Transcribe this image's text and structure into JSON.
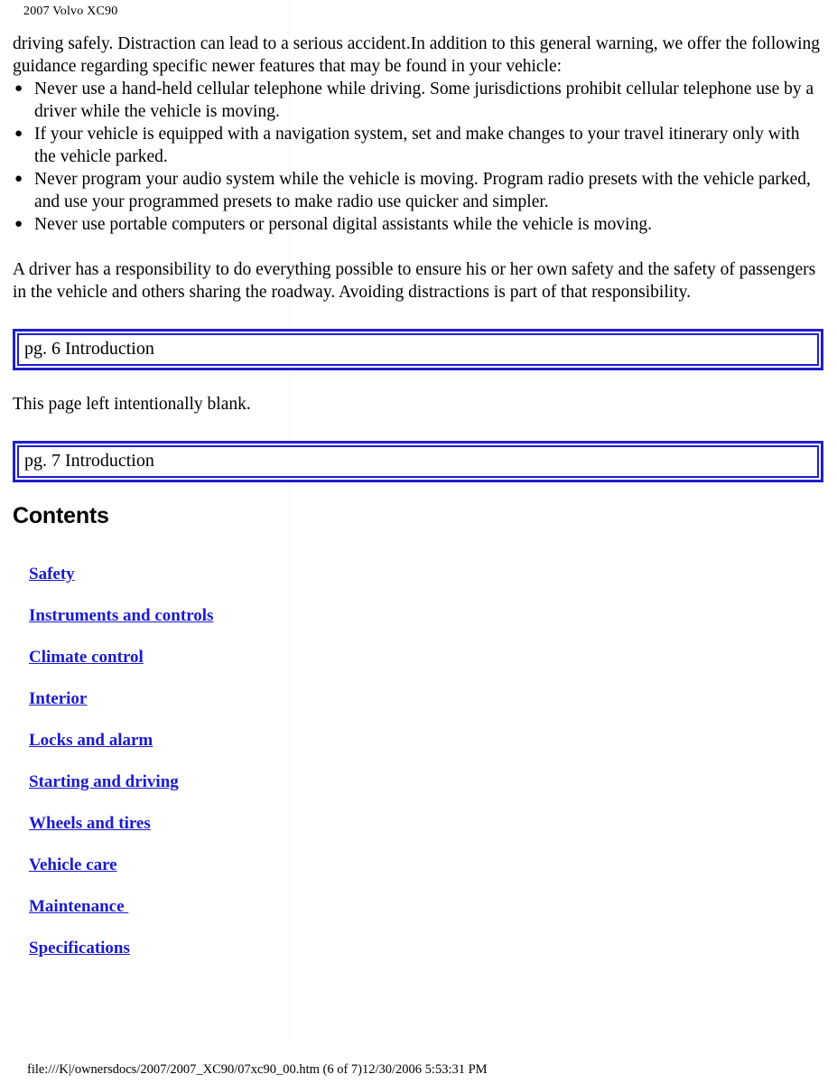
{
  "header": {
    "title": "2007 Volvo XC90"
  },
  "main": {
    "intro_paragraph": "driving safely. Distraction can lead to a serious accident.In addition to this general warning, we offer the following guidance regarding specific newer features that may be found in your vehicle:",
    "bullet_glyph": "●",
    "bullets": [
      "Never use a hand-held cellular telephone while driving. Some jurisdictions prohibit cellular telephone use by a driver while the vehicle is moving.",
      "If your vehicle is equipped with a navigation system, set and make changes to your travel itinerary only with the vehicle parked.",
      "Never program your audio system while the vehicle is moving. Program radio presets with the vehicle parked, and use your programmed presets to make radio use quicker and simpler.",
      "Never use portable computers or personal digital assistants while the vehicle is moving."
    ],
    "closing_paragraph": "A driver has a responsibility to do everything possible to ensure his or her own safety and the safety of passengers in the vehicle and others sharing the roadway. Avoiding distractions is part of that responsibility.",
    "page_box_1": "pg. 6 Introduction",
    "blank_page_note": "This page left intentionally blank.",
    "page_box_2": "pg. 7 Introduction",
    "contents_heading": "Contents",
    "contents_links": [
      "Safety",
      "Instruments and controls",
      "Climate control",
      "Interior",
      "Locks and alarm",
      "Starting and driving",
      "Wheels and tires",
      "Vehicle care",
      "Maintenance ",
      "Specifications"
    ]
  },
  "footer": {
    "path_and_timestamp": "file:///K|/ownersdocs/2007/2007_XC90/07xc90_00.htm (6 of 7)12/30/2006 5:53:31 PM"
  },
  "colors": {
    "link": "#1a1ad1",
    "box_border": "#1f1fcc",
    "text": "#000000",
    "background": "#ffffff"
  }
}
